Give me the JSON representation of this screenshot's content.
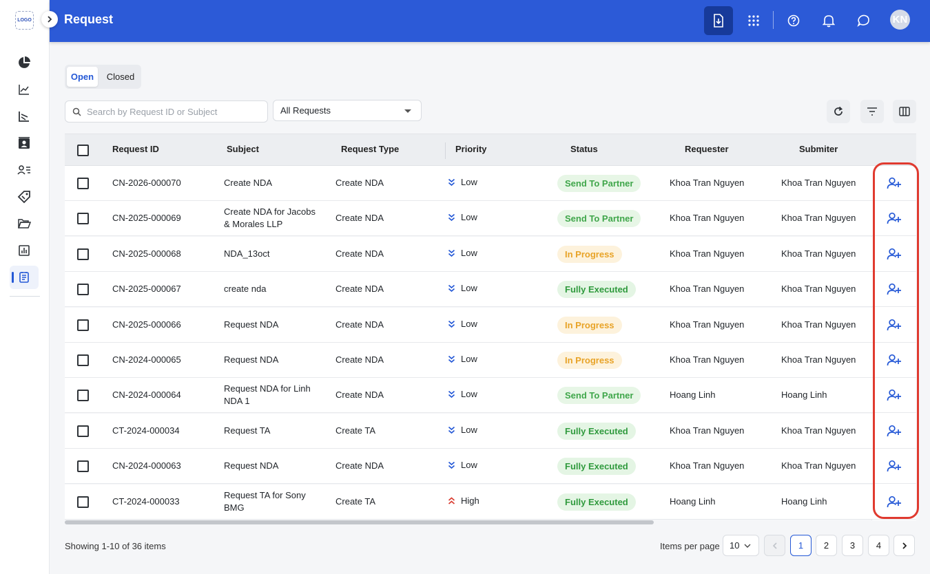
{
  "app": {
    "logo_text": "LOGO",
    "title": "Request",
    "user_initials": "KN"
  },
  "tabs": [
    {
      "label": "Open",
      "active": true
    },
    {
      "label": "Closed",
      "active": false
    }
  ],
  "search": {
    "placeholder": "Search by Request ID or Subject",
    "value": ""
  },
  "filter": {
    "selected": "All Requests"
  },
  "columns": [
    "Request ID",
    "Subject",
    "Request Type",
    "Priority",
    "Status",
    "Requester",
    "Submiter"
  ],
  "rows": [
    {
      "id": "CN-2026-000070",
      "subject": [
        "Create NDA"
      ],
      "type": "Create NDA",
      "priority": "Low",
      "status": "Send To Partner",
      "status_kind": "send",
      "requester": "Khoa Tran Nguyen",
      "submitter": "Khoa Tran Nguyen"
    },
    {
      "id": "CN-2025-000069",
      "subject": [
        "Create NDA for Jacobs",
        "& Morales LLP"
      ],
      "type": "Create NDA",
      "priority": "Low",
      "status": "Send To Partner",
      "status_kind": "send",
      "requester": "Khoa Tran Nguyen",
      "submitter": "Khoa Tran Nguyen"
    },
    {
      "id": "CN-2025-000068",
      "subject": [
        "NDA_13oct"
      ],
      "type": "Create NDA",
      "priority": "Low",
      "status": "In Progress",
      "status_kind": "progress",
      "requester": "Khoa Tran Nguyen",
      "submitter": "Khoa Tran Nguyen"
    },
    {
      "id": "CN-2025-000067",
      "subject": [
        "create nda"
      ],
      "type": "Create NDA",
      "priority": "Low",
      "status": "Fully Executed",
      "status_kind": "full",
      "requester": "Khoa Tran Nguyen",
      "submitter": "Khoa Tran Nguyen"
    },
    {
      "id": "CN-2025-000066",
      "subject": [
        "Request NDA"
      ],
      "type": "Create NDA",
      "priority": "Low",
      "status": "In Progress",
      "status_kind": "progress",
      "requester": "Khoa Tran Nguyen",
      "submitter": "Khoa Tran Nguyen"
    },
    {
      "id": "CN-2024-000065",
      "subject": [
        "Request NDA"
      ],
      "type": "Create NDA",
      "priority": "Low",
      "status": "In Progress",
      "status_kind": "progress",
      "requester": "Khoa Tran Nguyen",
      "submitter": "Khoa Tran Nguyen"
    },
    {
      "id": "CN-2024-000064",
      "subject": [
        "Request NDA for Linh",
        "NDA 1"
      ],
      "type": "Create NDA",
      "priority": "Low",
      "status": "Send To Partner",
      "status_kind": "send",
      "requester": "Hoang Linh",
      "submitter": "Hoang Linh"
    },
    {
      "id": "CT-2024-000034",
      "subject": [
        "Request TA"
      ],
      "type": "Create TA",
      "priority": "Low",
      "status": "Fully Executed",
      "status_kind": "full",
      "requester": "Khoa Tran Nguyen",
      "submitter": "Khoa Tran Nguyen"
    },
    {
      "id": "CN-2024-000063",
      "subject": [
        "Request NDA"
      ],
      "type": "Create NDA",
      "priority": "Low",
      "status": "Fully Executed",
      "status_kind": "full",
      "requester": "Khoa Tran Nguyen",
      "submitter": "Khoa Tran Nguyen"
    },
    {
      "id": "CT-2024-000033",
      "subject": [
        "Request TA for Sony",
        "BMG"
      ],
      "type": "Create TA",
      "priority": "High",
      "status": "Fully Executed",
      "status_kind": "full",
      "requester": "Hoang Linh",
      "submitter": "Hoang Linh"
    }
  ],
  "footer": {
    "summary": "Showing 1-10 of 36 items",
    "items_per_page_label": "Items per page",
    "items_per_page": "10",
    "pages": [
      "1",
      "2",
      "3",
      "4"
    ],
    "current_page": "1"
  },
  "colors": {
    "header": "#2c5ad7",
    "accent": "#2458d6",
    "highlight": "#e03a2f",
    "priority_low": "#2458d6",
    "priority_high": "#d93b30"
  },
  "icons": {
    "sidebar": [
      "pie-chart-icon",
      "trend-line-icon",
      "chart-axis-icon",
      "contact-card-icon",
      "user-list-icon",
      "tag-icon",
      "folder-open-icon",
      "report-chart-icon",
      "request-document-icon"
    ],
    "header": [
      "download-document-icon",
      "apps-grid-icon",
      "help-icon",
      "bell-icon",
      "chat-icon"
    ],
    "tools": [
      "refresh-icon",
      "filter-icon",
      "columns-icon"
    ],
    "row_action": "assign-user-icon"
  }
}
